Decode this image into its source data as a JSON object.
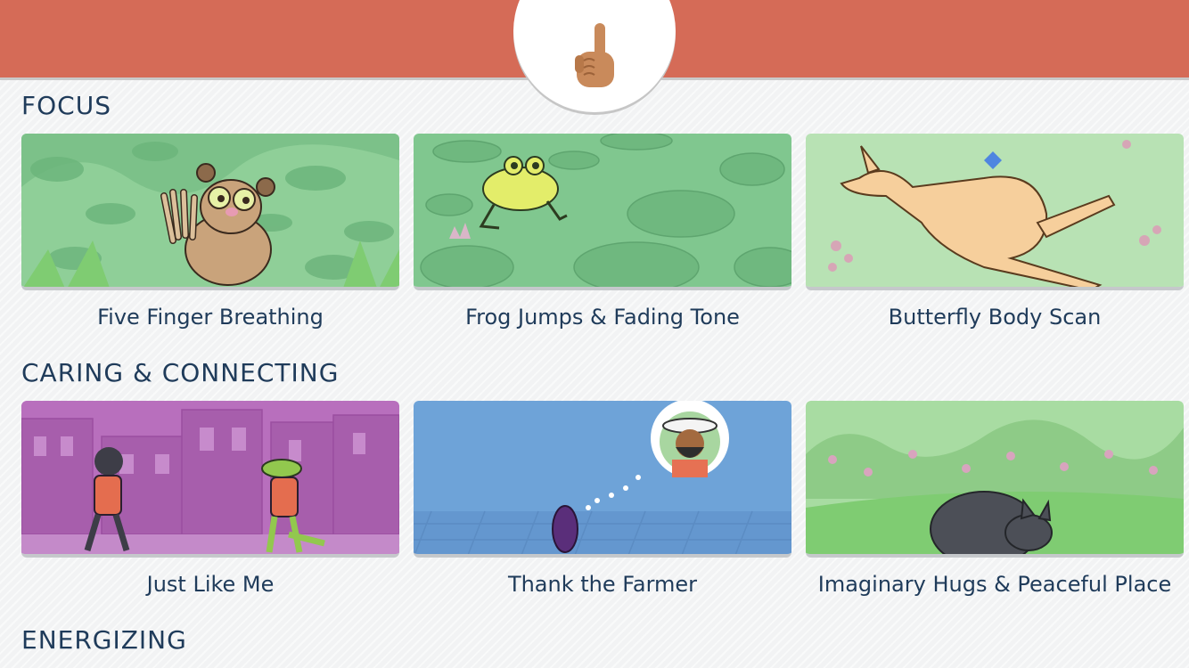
{
  "header": {
    "home_icon": "pointing-up-hand-icon",
    "accent": "#d56b57"
  },
  "sections": [
    {
      "title": "FOCUS",
      "items": [
        {
          "label": "Five Finger Breathing",
          "image": "tarsier-illustration"
        },
        {
          "label": "Frog Jumps & Fading Tone",
          "image": "frog-illustration"
        },
        {
          "label": "Butterfly Body Scan",
          "image": "kangaroo-illustration"
        }
      ]
    },
    {
      "title": "CARING & CONNECTING",
      "items": [
        {
          "label": "Just Like Me",
          "image": "horse-crocodile-illustration"
        },
        {
          "label": "Thank the Farmer",
          "image": "raisin-farmer-illustration"
        },
        {
          "label": "Imaginary Hugs & Peaceful Place",
          "image": "sleeping-cat-illustration"
        }
      ]
    },
    {
      "title": "ENERGIZING",
      "items": []
    }
  ]
}
